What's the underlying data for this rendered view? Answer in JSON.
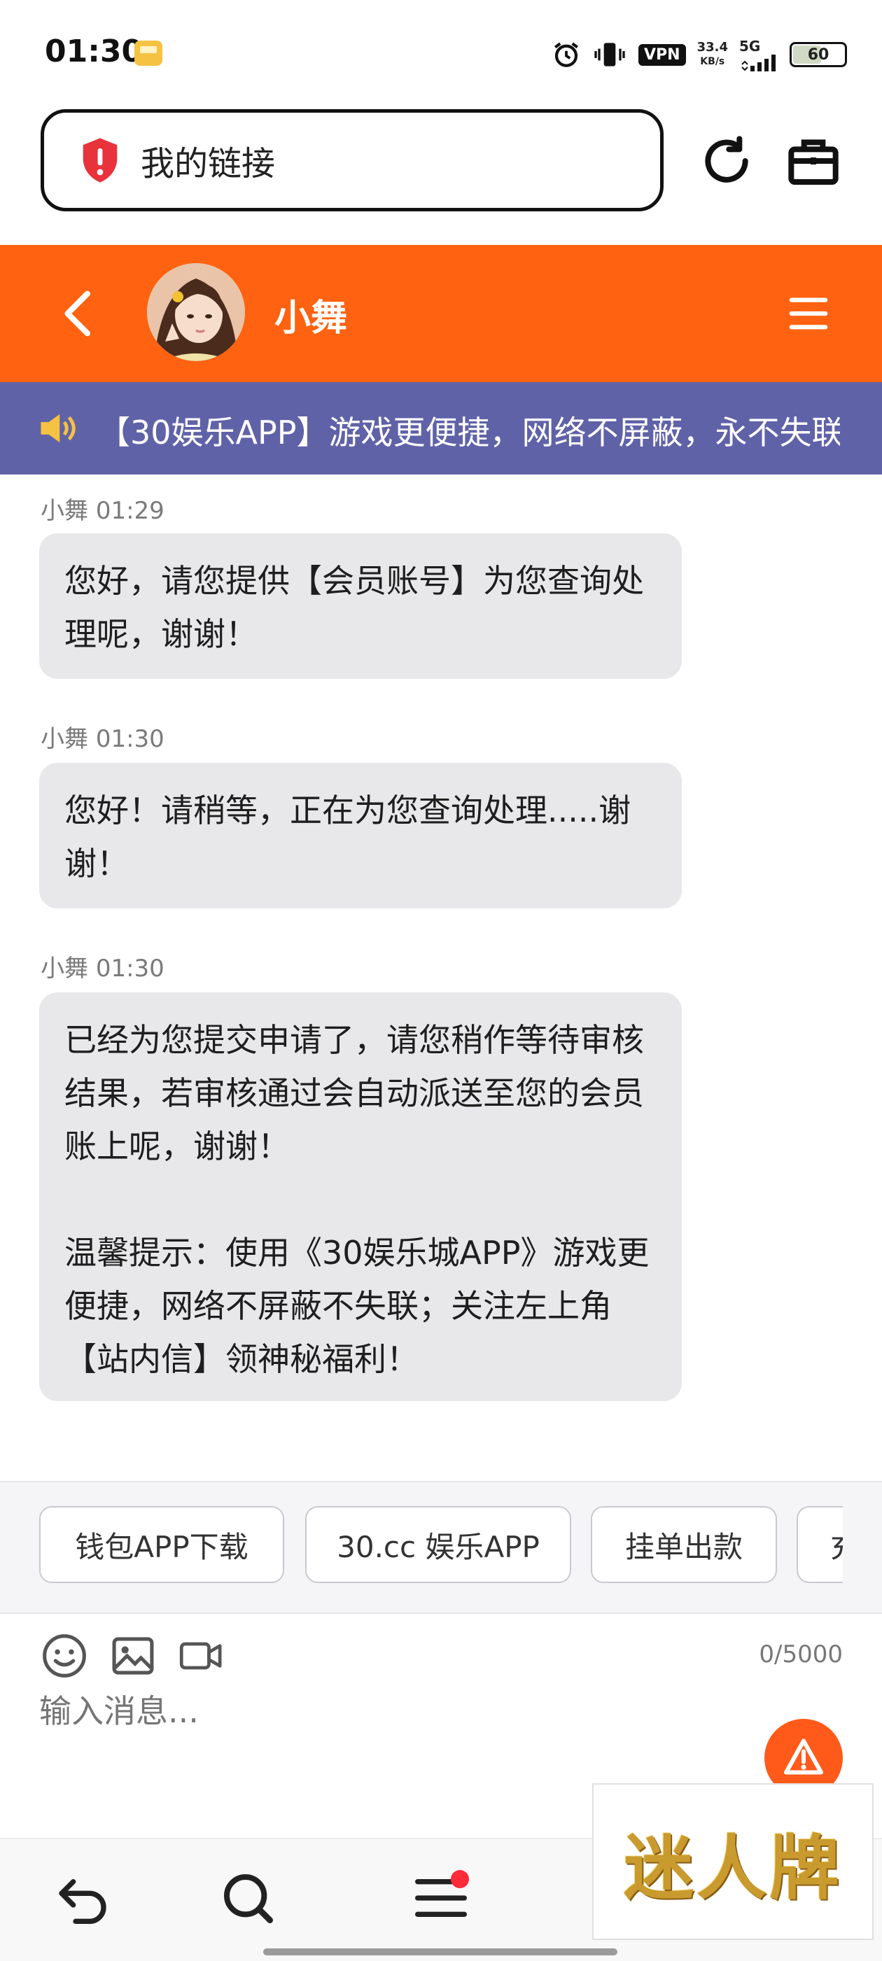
{
  "status_bar": {
    "time": "01:30",
    "network_speed_value": "33.4",
    "network_speed_unit": "KB/s",
    "vpn_label": "VPN",
    "network_type": "5G",
    "battery_level": "60"
  },
  "browser": {
    "url_text": "我的链接",
    "icons": [
      "security-warning-icon",
      "reload-icon",
      "toolbox-icon"
    ]
  },
  "chat_header": {
    "agent_name": "小舞",
    "icons": [
      "back-arrow-icon",
      "menu-icon"
    ]
  },
  "announcement": {
    "text": "【30娱乐APP】游戏更便捷，网络不屏蔽，永不失联"
  },
  "messages": [
    {
      "sender": "小舞",
      "time": "01:29",
      "text": "您好，请您提供【会员账号】为您查询处理呢，谢谢！"
    },
    {
      "sender": "小舞",
      "time": "01:30",
      "text": "您好！请稍等，正在为您查询处理.....谢谢！"
    },
    {
      "sender": "小舞",
      "time": "01:30",
      "text": "已经为您提交申请了，请您稍作等待审核结果，若审核通过会自动派送至您的会员账上呢，谢谢！\n\n温馨提示：使用《30娱乐城APP》游戏更便捷，网络不屏蔽不失联；关注左上角【站内信】领神秘福利！"
    }
  ],
  "quick_replies": [
    "钱包APP下载",
    "30.cc 娱乐APP",
    "挂单出款",
    "充"
  ],
  "composer": {
    "counter": "0/5000",
    "placeholder": "输入消息...",
    "icons": [
      "emoji-icon",
      "image-icon",
      "video-icon",
      "warning-icon"
    ]
  },
  "bottom_nav": {
    "icons": [
      "back-icon",
      "search-icon",
      "menu-icon"
    ],
    "menu_has_badge": true
  },
  "brand_overlay": {
    "text": "迷人牌"
  },
  "colors": {
    "header_orange": "#ff6210",
    "announcement_purple": "#6062a8",
    "bubble_gray": "#e8e8ea",
    "warning_red": "#e8323c",
    "badge_red": "#ff2a3a"
  }
}
